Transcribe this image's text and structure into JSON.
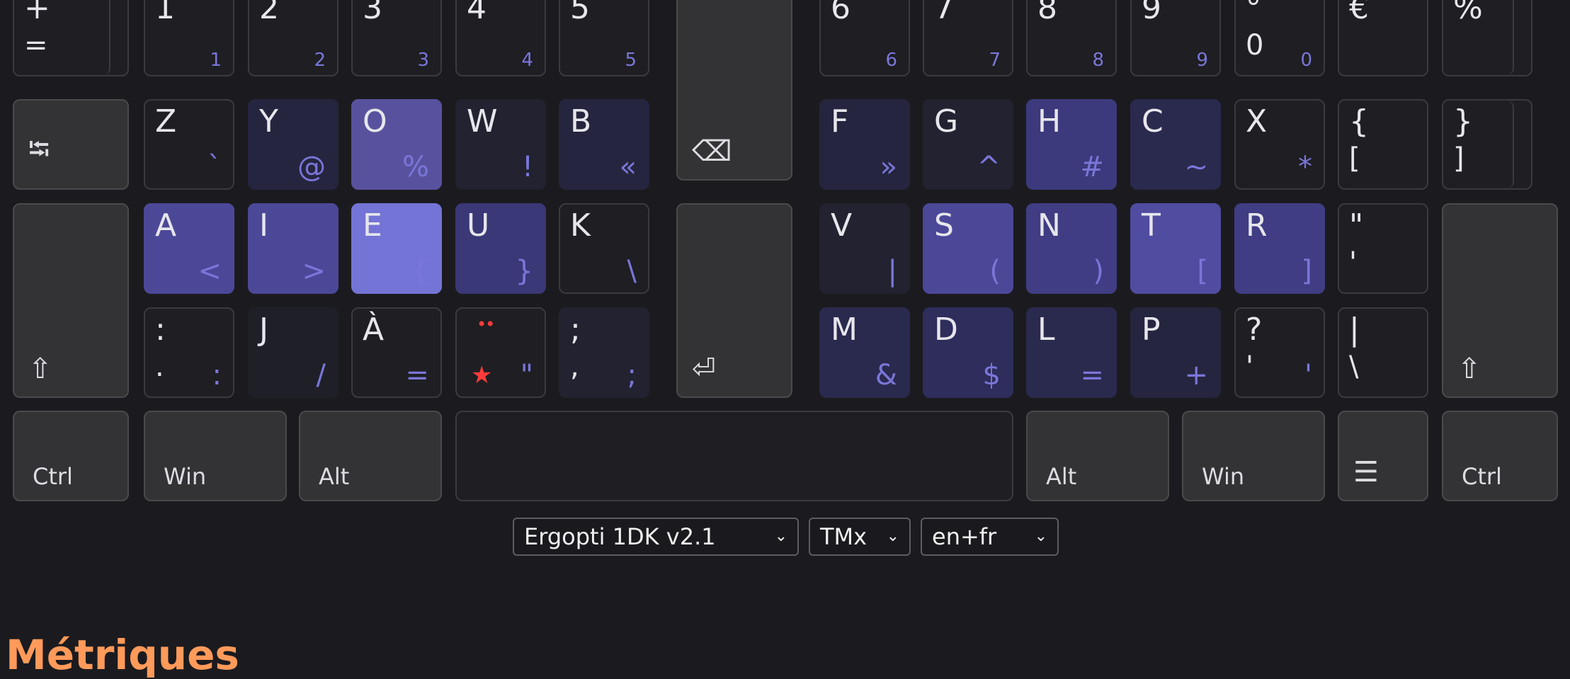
{
  "layout_selector": {
    "value": "Ergopti 1DK v2.1",
    "variant": "TMx",
    "language": "en+fr"
  },
  "section_title": "Métriques",
  "colors": {
    "background": "#1b1b1f",
    "accent_title": "#ff9a5a",
    "hint": "#ff3b3b"
  },
  "keys": [
    {
      "id": "plus-equals",
      "top": "+",
      "low": "="
    },
    {
      "id": "1",
      "top": "1",
      "alt": "1",
      "alt_small": true
    },
    {
      "id": "2",
      "top": "2",
      "alt": "2",
      "alt_small": true
    },
    {
      "id": "3",
      "top": "3",
      "alt": "3",
      "alt_small": true
    },
    {
      "id": "4",
      "top": "4",
      "alt": "4",
      "alt_small": true
    },
    {
      "id": "5",
      "top": "5",
      "alt": "5",
      "alt_small": true
    },
    {
      "id": "backspace",
      "icon": "backspace-icon",
      "glyph": "⌫"
    },
    {
      "id": "6",
      "top": "6",
      "alt": "6",
      "alt_small": true
    },
    {
      "id": "7",
      "top": "7",
      "alt": "7",
      "alt_small": true
    },
    {
      "id": "8",
      "top": "8",
      "alt": "8",
      "alt_small": true
    },
    {
      "id": "9",
      "top": "9",
      "alt": "9",
      "alt_small": true
    },
    {
      "id": "0",
      "top": "°",
      "low": "0",
      "alt": "0",
      "alt_small": true
    },
    {
      "id": "euro",
      "top": "€"
    },
    {
      "id": "percent",
      "top": "%"
    },
    {
      "id": "tab",
      "icon": "tab-icon",
      "glyph": "⭾"
    },
    {
      "id": "z",
      "top": "Z",
      "alt": "`"
    },
    {
      "id": "y",
      "top": "Y",
      "alt": "@"
    },
    {
      "id": "o",
      "top": "O",
      "alt": "%"
    },
    {
      "id": "w",
      "top": "W",
      "alt": "!"
    },
    {
      "id": "b",
      "top": "B",
      "alt": "«"
    },
    {
      "id": "f",
      "top": "F",
      "alt": "»"
    },
    {
      "id": "g",
      "top": "G",
      "alt": "^"
    },
    {
      "id": "h",
      "top": "H",
      "alt": "#"
    },
    {
      "id": "c",
      "top": "C",
      "alt": "~"
    },
    {
      "id": "x",
      "top": "X",
      "alt": "*"
    },
    {
      "id": "brace-bracket-left",
      "top": "{",
      "low": "["
    },
    {
      "id": "brace-bracket-right",
      "top": "}",
      "low": "]"
    },
    {
      "id": "shift-left",
      "icon": "shift-icon",
      "glyph": "⇧"
    },
    {
      "id": "a",
      "top": "A",
      "alt": "<"
    },
    {
      "id": "i",
      "top": "I",
      "alt": ">"
    },
    {
      "id": "e",
      "top": "E",
      "alt": "{"
    },
    {
      "id": "u",
      "top": "U",
      "alt": "}"
    },
    {
      "id": "k",
      "top": "K",
      "alt": "\\"
    },
    {
      "id": "enter",
      "icon": "enter-icon",
      "glyph": "⏎"
    },
    {
      "id": "v",
      "top": "V",
      "alt": "|"
    },
    {
      "id": "s",
      "top": "S",
      "alt": "("
    },
    {
      "id": "n",
      "top": "N",
      "alt": ")"
    },
    {
      "id": "t",
      "top": "T",
      "alt": "["
    },
    {
      "id": "r",
      "top": "R",
      "alt": "]"
    },
    {
      "id": "quotes",
      "top": "\"",
      "low": "'"
    },
    {
      "id": "shift-right",
      "icon": "shift-icon",
      "glyph": "⇧"
    },
    {
      "id": "colon",
      "top": ":",
      "low": ".",
      "alt": ":"
    },
    {
      "id": "j",
      "top": "J",
      "alt": "/"
    },
    {
      "id": "a-grave",
      "top": "À",
      "alt": "="
    },
    {
      "id": "dead-key",
      "hint1": "••",
      "hint2": "★",
      "alt": "\""
    },
    {
      "id": "semicolon",
      "top": ";",
      "low": ",",
      "alt": ";"
    },
    {
      "id": "m",
      "top": "M",
      "alt": "&"
    },
    {
      "id": "d",
      "top": "D",
      "alt": "$"
    },
    {
      "id": "l",
      "top": "L",
      "alt": "="
    },
    {
      "id": "p",
      "top": "P",
      "alt": "+"
    },
    {
      "id": "question",
      "top": "?",
      "low": "'",
      "alt": "'"
    },
    {
      "id": "pipe",
      "top": "|",
      "low": "\\"
    },
    {
      "id": "ctrl-left",
      "label": "Ctrl"
    },
    {
      "id": "win-left",
      "label": "Win"
    },
    {
      "id": "alt-left",
      "label": "Alt"
    },
    {
      "id": "space"
    },
    {
      "id": "alt-right",
      "label": "Alt"
    },
    {
      "id": "win-right",
      "label": "Win"
    },
    {
      "id": "menu",
      "icon": "menu-icon",
      "glyph": "☰"
    },
    {
      "id": "ctrl-right",
      "label": "Ctrl"
    }
  ]
}
